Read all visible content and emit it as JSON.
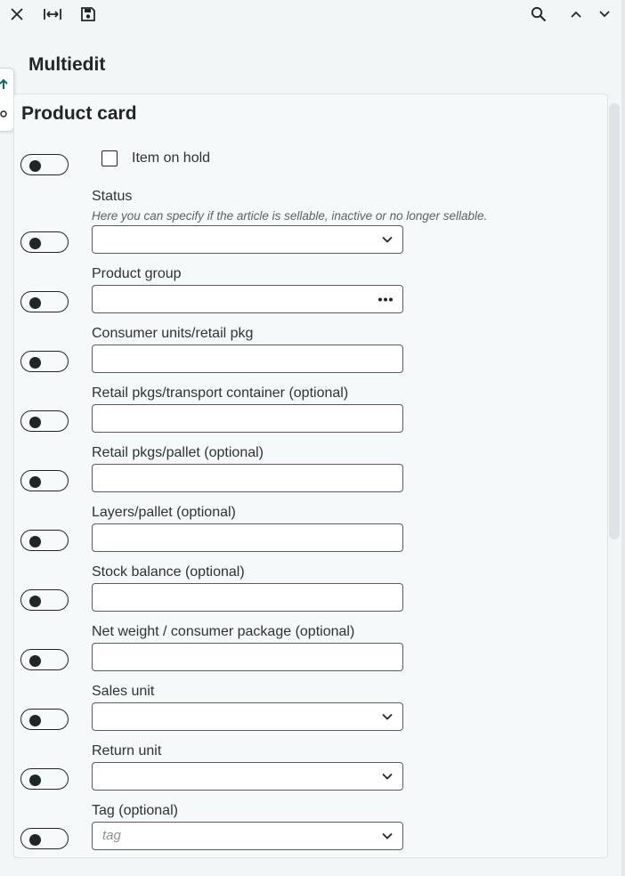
{
  "toolbar": {
    "icons": [
      "close-icon",
      "fit-width-icon",
      "save-icon",
      "search-icon",
      "chevron-up-icon",
      "chevron-down-icon"
    ]
  },
  "page": {
    "title": "Multiedit"
  },
  "card": {
    "title": "Product card",
    "checkbox_field": {
      "label": "Item on hold",
      "checked": false
    },
    "fields": [
      {
        "label": "Status",
        "hint": "Here you can specify if the article is sellable, inactive or no longer sellable.",
        "type": "select",
        "value": ""
      },
      {
        "label": "Product group",
        "type": "lookup",
        "value": ""
      },
      {
        "label": "Consumer units/retail pkg",
        "type": "text",
        "value": ""
      },
      {
        "label": "Retail pkgs/transport container (optional)",
        "type": "text",
        "value": ""
      },
      {
        "label": "Retail pkgs/pallet (optional)",
        "type": "text",
        "value": ""
      },
      {
        "label": "Layers/pallet (optional)",
        "type": "text",
        "value": ""
      },
      {
        "label": "Stock balance (optional)",
        "type": "text",
        "value": ""
      },
      {
        "label": "Net weight / consumer package (optional)",
        "type": "text",
        "value": ""
      },
      {
        "label": "Sales unit",
        "type": "select",
        "value": ""
      },
      {
        "label": "Return unit",
        "type": "select",
        "value": ""
      },
      {
        "label": "Tag (optional)",
        "type": "select",
        "value": "",
        "placeholder": "tag"
      }
    ]
  },
  "colors": {
    "text": "#1e2628",
    "border": "#555d60",
    "card_bg": "#f5f9fa",
    "page_bg": "#f3f6f7",
    "accent": "#0b6e6e"
  }
}
